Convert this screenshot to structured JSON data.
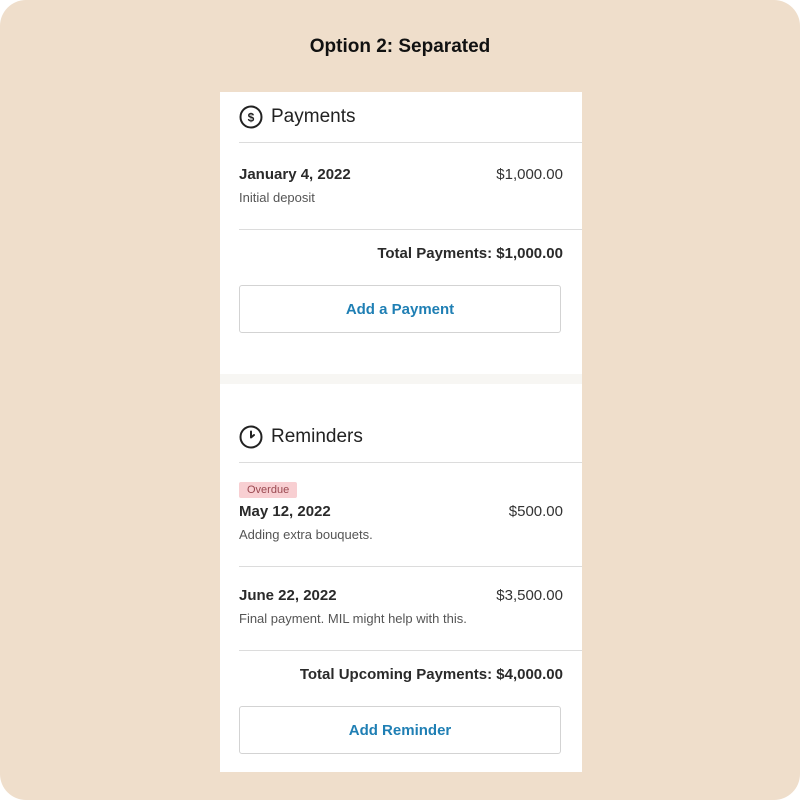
{
  "page_title": "Option 2: Separated",
  "payments": {
    "title": "Payments",
    "icon": "dollar-circle-icon",
    "items": [
      {
        "date": "January 4, 2022",
        "amount": "$1,000.00",
        "note": "Initial deposit"
      }
    ],
    "total_label": "Total Payments:",
    "total_value": "$1,000.00",
    "button_label": "Add a Payment"
  },
  "reminders": {
    "title": "Reminders",
    "icon": "clock-icon",
    "items": [
      {
        "badge": "Overdue",
        "date": "May 12, 2022",
        "amount": "$500.00",
        "note": "Adding extra bouquets."
      },
      {
        "date": "June 22, 2022",
        "amount": "$3,500.00",
        "note": "Final payment. MIL might help with this."
      }
    ],
    "total_label": "Total Upcoming Payments:",
    "total_value": "$4,000.00",
    "button_label": "Add Reminder"
  },
  "colors": {
    "background": "#efdecb",
    "accent": "#1f7fb4",
    "overdue_badge_bg": "#f8cfd2",
    "overdue_badge_text": "#9a4850"
  }
}
